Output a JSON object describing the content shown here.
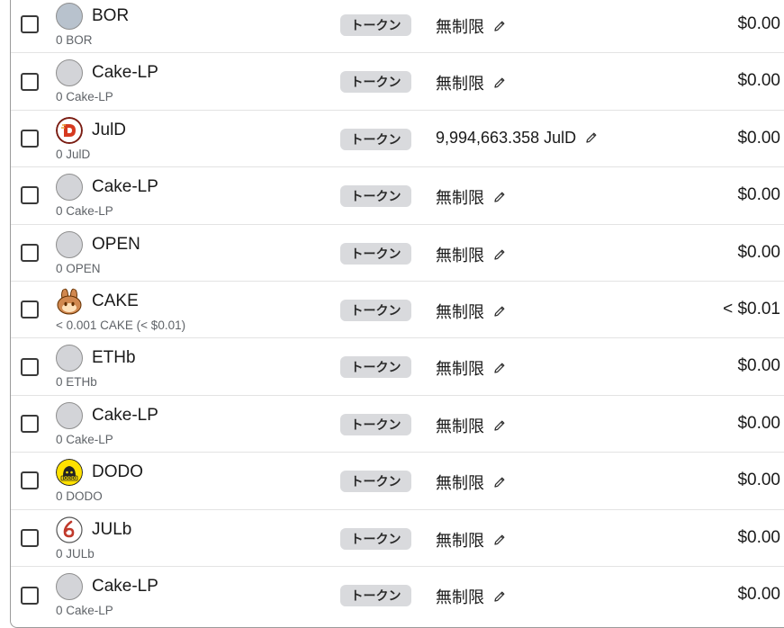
{
  "rows": [
    {
      "name": "BOR",
      "balance": "0 BOR",
      "type": "トークン",
      "allowance": "無制限",
      "value": "$0.00",
      "icon": "placeholder-icon-blue"
    },
    {
      "name": "Cake-LP",
      "balance": "0 Cake-LP",
      "type": "トークン",
      "allowance": "無制限",
      "value": "$0.00",
      "icon": "placeholder-icon"
    },
    {
      "name": "JulD",
      "balance": "0 JulD",
      "type": "トークン",
      "allowance": "9,994,663.358 JulD",
      "value": "$0.00",
      "icon": "juld-logo-icon"
    },
    {
      "name": "Cake-LP",
      "balance": "0 Cake-LP",
      "type": "トークン",
      "allowance": "無制限",
      "value": "$0.00",
      "icon": "placeholder-icon"
    },
    {
      "name": "OPEN",
      "balance": "0 OPEN",
      "type": "トークン",
      "allowance": "無制限",
      "value": "$0.00",
      "icon": "placeholder-icon"
    },
    {
      "name": "CAKE",
      "balance": "< 0.001 CAKE (< $0.01)",
      "type": "トークン",
      "allowance": "無制限",
      "value": "< $0.01",
      "icon": "pancakeswap-bunny-icon"
    },
    {
      "name": "ETHb",
      "balance": "0 ETHb",
      "type": "トークン",
      "allowance": "無制限",
      "value": "$0.00",
      "icon": "placeholder-icon"
    },
    {
      "name": "Cake-LP",
      "balance": "0 Cake-LP",
      "type": "トークン",
      "allowance": "無制限",
      "value": "$0.00",
      "icon": "placeholder-icon"
    },
    {
      "name": "DODO",
      "balance": "0 DODO",
      "type": "トークン",
      "allowance": "無制限",
      "value": "$0.00",
      "icon": "dodo-logo-icon"
    },
    {
      "name": "JULb",
      "balance": "0 JULb",
      "type": "トークン",
      "allowance": "無制限",
      "value": "$0.00",
      "icon": "julb-logo-icon"
    },
    {
      "name": "Cake-LP",
      "balance": "0 Cake-LP",
      "type": "トークン",
      "allowance": "無制限",
      "value": "$0.00",
      "icon": "placeholder-icon"
    }
  ],
  "colors": {
    "badge_bg": "#d9dadd",
    "border": "#9a9a9a",
    "row_divider": "#e3e3e3",
    "placeholder_icon": "#d3d4d8",
    "dodo_yellow": "#ffe100",
    "cake_brown": "#d1884f",
    "jul_red": "#c0392b"
  }
}
